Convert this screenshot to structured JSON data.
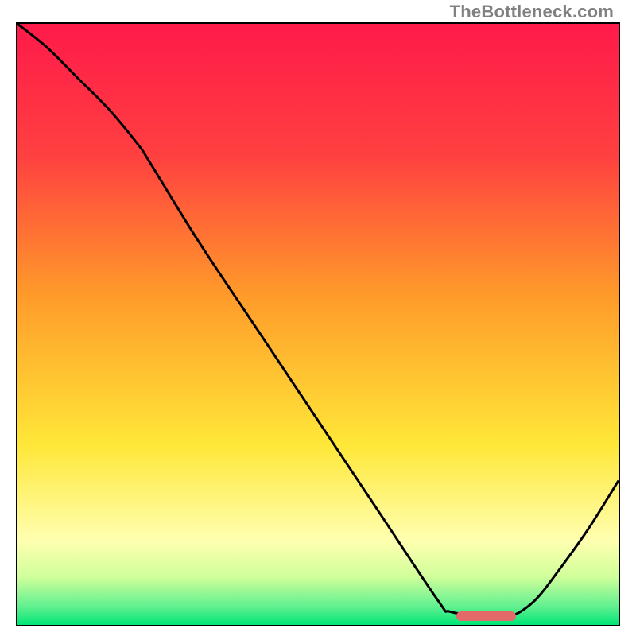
{
  "watermark": "TheBottleneck.com",
  "colors": {
    "red": "#ff1a4a",
    "orange": "#ff8a2a",
    "yellow": "#ffe738",
    "paleyellow": "#ffffb0",
    "greenlight": "#c8ff94",
    "green": "#00e676",
    "curve": "#000000",
    "marker": "#e46a6a",
    "border": "#000000"
  },
  "chart_data": {
    "type": "line",
    "title": "",
    "xlabel": "",
    "ylabel": "",
    "xlim": [
      0,
      100
    ],
    "ylim": [
      0,
      100
    ],
    "series": [
      {
        "name": "bottleneck-curve",
        "x": [
          0,
          5,
          10,
          15,
          20,
          22,
          30,
          40,
          50,
          60,
          70,
          72,
          78,
          82,
          86,
          90,
          95,
          100
        ],
        "y": [
          100,
          96,
          91,
          86,
          80,
          77,
          64,
          49,
          34,
          19,
          4,
          2.2,
          1.4,
          1.4,
          4,
          9,
          16,
          24
        ]
      }
    ],
    "marker": {
      "x_start": 73,
      "x_end": 83,
      "y": 1.4
    },
    "gradient_stops": [
      {
        "pct": 0,
        "color": "#ff1a4a"
      },
      {
        "pct": 22,
        "color": "#ff4040"
      },
      {
        "pct": 45,
        "color": "#ff9a2a"
      },
      {
        "pct": 70,
        "color": "#ffe738"
      },
      {
        "pct": 86,
        "color": "#ffffb0"
      },
      {
        "pct": 92,
        "color": "#d0ff9a"
      },
      {
        "pct": 97,
        "color": "#60f090"
      },
      {
        "pct": 100,
        "color": "#00e676"
      }
    ]
  }
}
